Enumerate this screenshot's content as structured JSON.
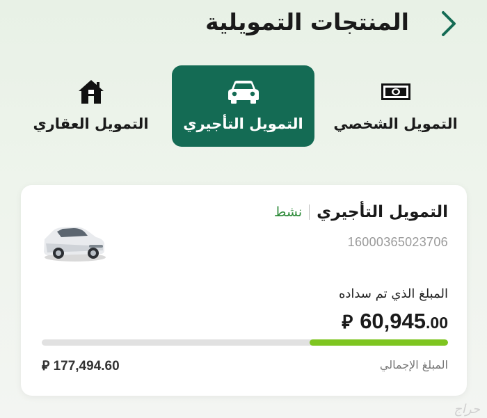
{
  "header": {
    "title": "المنتجات التمويلية"
  },
  "tabs": [
    {
      "label": "التمويل العقاري",
      "icon": "home-icon",
      "active": false
    },
    {
      "label": "التمويل التأجيري",
      "icon": "car-icon",
      "active": true
    },
    {
      "label": "التمويل الشخصي",
      "icon": "cash-icon",
      "active": false
    }
  ],
  "card": {
    "title": "التمويل التأجيري",
    "status": "نشط",
    "account_number": "16000365023706",
    "paid_label": "المبلغ الذي تم سداده",
    "paid_amount_int": "60,945",
    "paid_amount_dec": ".00",
    "currency_symbol": "⃁",
    "progress_fraction": 0.34,
    "total_label": "المبلغ الإجمالي",
    "total_amount": "177,494.60"
  },
  "colors": {
    "primary": "#146b54",
    "progress": "#7ec520",
    "status": "#2e8b3a"
  },
  "watermark": "حراج"
}
